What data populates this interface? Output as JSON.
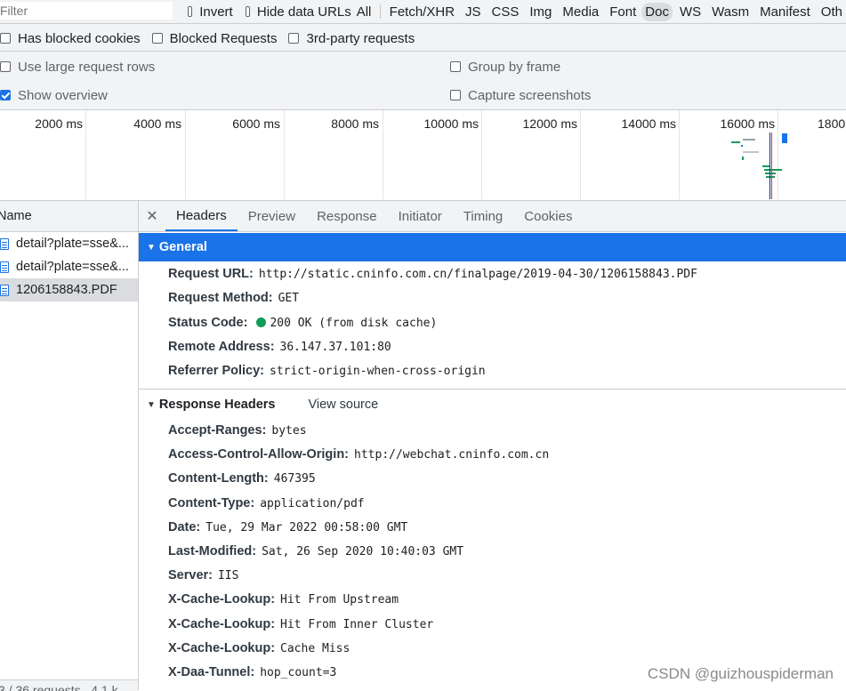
{
  "toolbar": {
    "filter_placeholder": "Filter",
    "invert_label": "Invert",
    "hide_data_urls_label": "Hide data URLs",
    "types": [
      "All",
      "Fetch/XHR",
      "JS",
      "CSS",
      "Img",
      "Media",
      "Font",
      "Doc",
      "WS",
      "Wasm",
      "Manifest",
      "Oth"
    ],
    "active_type": "Doc"
  },
  "filters2": {
    "blocked_cookies": "Has blocked cookies",
    "blocked_requests": "Blocked Requests",
    "third_party": "3rd-party requests"
  },
  "settings": {
    "large_rows": "Use large request rows",
    "group_by_frame": "Group by frame",
    "show_overview": "Show overview",
    "capture_screenshots": "Capture screenshots"
  },
  "overview": {
    "ticks": [
      "2000 ms",
      "4000 ms",
      "6000 ms",
      "8000 ms",
      "10000 ms",
      "12000 ms",
      "14000 ms",
      "16000 ms",
      "1800"
    ]
  },
  "request_list": {
    "column_name": "Name",
    "items": [
      "detail?plate=sse&...",
      "detail?plate=sse&...",
      "1206158843.PDF"
    ],
    "footer": "3 / 36 requests   4.1 k"
  },
  "detail_tabs": [
    "Headers",
    "Preview",
    "Response",
    "Initiator",
    "Timing",
    "Cookies"
  ],
  "general": {
    "title": "General",
    "request_url_key": "Request URL:",
    "request_url": "http://static.cninfo.com.cn/finalpage/2019-04-30/1206158843.PDF",
    "request_method_key": "Request Method:",
    "request_method": "GET",
    "status_code_key": "Status Code:",
    "status_code": "200 OK (from disk cache)",
    "remote_address_key": "Remote Address:",
    "remote_address": "36.147.37.101:80",
    "referrer_policy_key": "Referrer Policy:",
    "referrer_policy": "strict-origin-when-cross-origin"
  },
  "response_headers": {
    "title": "Response Headers",
    "view_source": "View source",
    "items": [
      {
        "k": "Accept-Ranges:",
        "v": "bytes"
      },
      {
        "k": "Access-Control-Allow-Origin:",
        "v": "http://webchat.cninfo.com.cn"
      },
      {
        "k": "Content-Length:",
        "v": "467395"
      },
      {
        "k": "Content-Type:",
        "v": "application/pdf"
      },
      {
        "k": "Date:",
        "v": "Tue, 29 Mar 2022 00:58:00 GMT"
      },
      {
        "k": "Last-Modified:",
        "v": "Sat, 26 Sep 2020 10:40:03 GMT"
      },
      {
        "k": "Server:",
        "v": "IIS"
      },
      {
        "k": "X-Cache-Lookup:",
        "v": "Hit From Upstream"
      },
      {
        "k": "X-Cache-Lookup:",
        "v": "Hit From Inner Cluster"
      },
      {
        "k": "X-Cache-Lookup:",
        "v": "Cache Miss"
      },
      {
        "k": "X-Daa-Tunnel:",
        "v": "hop_count=3"
      }
    ]
  },
  "watermark": "CSDN @guizhouspiderman",
  "colors": {
    "accent": "#1a73e8",
    "status_ok": "#0f9d58"
  }
}
